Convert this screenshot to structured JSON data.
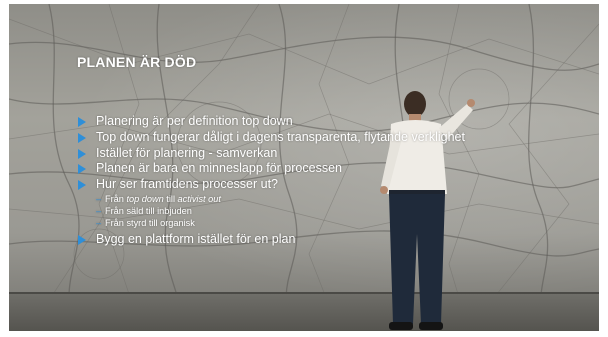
{
  "slide": {
    "title": "PLANEN ÄR DÖD",
    "bullets": [
      "Planering är per definition top down",
      "Top down fungerar dåligt i dagens transparenta, flytande verklighet",
      "Istället för planering - samverkan",
      "Planen är bara en minneslapp för processen",
      "Hur ser framtidens processer ut?"
    ],
    "sub_bullets": [
      {
        "pre": "Från ",
        "em1": "top down",
        "mid": " till ",
        "em2": "activist out"
      },
      {
        "text": "Från säld till inbjuden"
      },
      {
        "text": "Från styrd till organisk"
      }
    ],
    "last_bullet": "Bygg en plattform istället för en plan"
  },
  "colors": {
    "accent": "#2f8fd8",
    "text": "#ffffff"
  },
  "icons": {
    "bullet": "arrow-bullet-icon",
    "sub_bullet": "dash-bullet-icon"
  }
}
